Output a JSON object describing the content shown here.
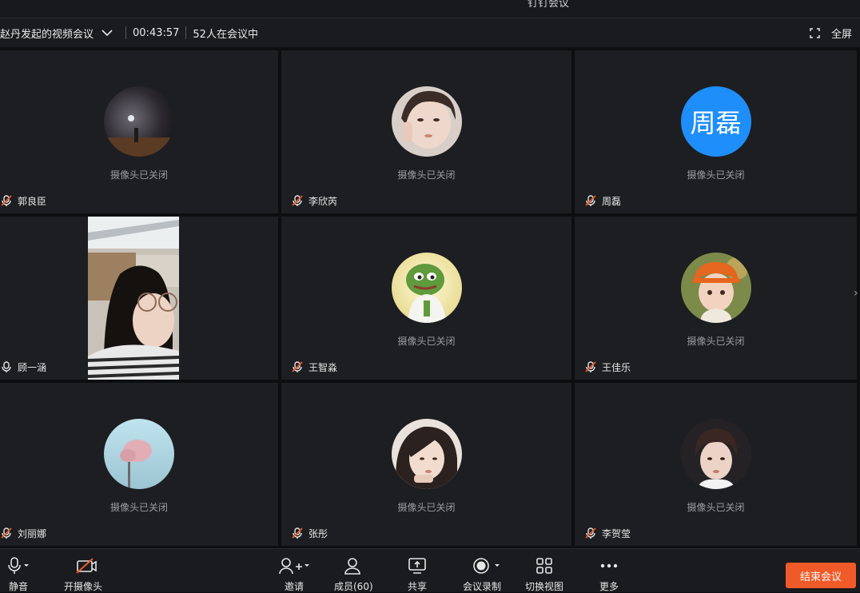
{
  "app": {
    "title": "钉钉会议"
  },
  "meeting": {
    "title": "赵丹发起的视频会议",
    "elapsed": "00:43:57",
    "participants_text": "52人在会议中",
    "fullscreen_label": "全屏"
  },
  "camera_off_text": "摄像头已关闭",
  "participants": [
    {
      "name": "郭良臣",
      "status": "摄像头已关闭",
      "avatar": "photo"
    },
    {
      "name": "李欣芮",
      "status": "摄像头已关闭",
      "avatar": "photo"
    },
    {
      "name": "周磊",
      "status": "摄像头已关闭",
      "avatar": "text",
      "avatar_text": "周磊"
    },
    {
      "name": "顾一涵",
      "status": "",
      "avatar": "video"
    },
    {
      "name": "王智淼",
      "status": "摄像头已关闭",
      "avatar": "photo"
    },
    {
      "name": "王佳乐",
      "status": "摄像头已关闭",
      "avatar": "photo"
    },
    {
      "name": "刘丽娜",
      "status": "摄像头已关闭",
      "avatar": "photo"
    },
    {
      "name": "张彤",
      "status": "摄像头已关闭",
      "avatar": "photo"
    },
    {
      "name": "李贺莹",
      "status": "摄像头已关闭",
      "avatar": "photo"
    }
  ],
  "toolbar": {
    "mute": "静音",
    "camera": "开摄像头",
    "invite": "邀请",
    "members": "成员(60)",
    "share": "共享",
    "record": "会议录制",
    "switch_view": "切换视图",
    "more": "更多",
    "end": "结束会议"
  },
  "colors": {
    "accent": "#1e8efa",
    "end_button": "#f05a28",
    "mic_muted": "#f05a28"
  }
}
